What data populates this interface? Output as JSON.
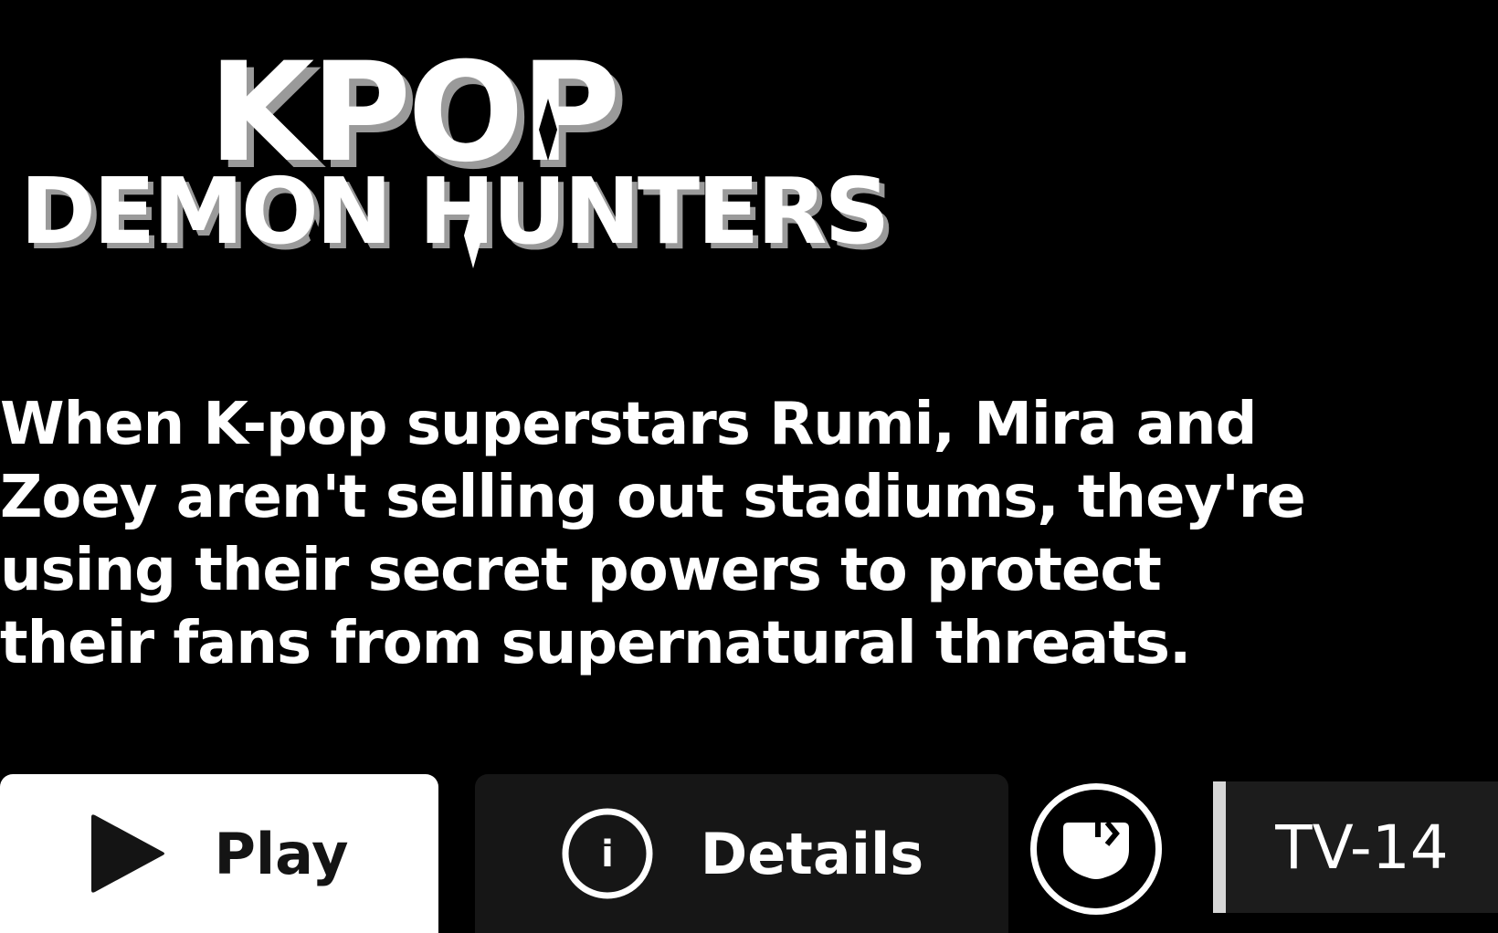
{
  "title": {
    "line1": "KPOP",
    "line2": "DEMON HUNTERS"
  },
  "synopsis": "When K-pop superstars Rumi, Mira and Zoey aren't selling out stadiums, they're using their secret powers to protect their fans from supernatural threats.",
  "actions": {
    "play_label": "Play",
    "details_label": "Details",
    "info_glyph": "i"
  },
  "maturity_rating": "TV-14",
  "icons": {
    "play": "play-icon",
    "info": "info-icon",
    "mute": "volume-muted-icon"
  },
  "colors": {
    "background": "#000000",
    "play_button": "#ffffff",
    "details_button": "#161616",
    "rating_badge": "#1c1c1c",
    "rating_bar": "#d6d6d6"
  }
}
